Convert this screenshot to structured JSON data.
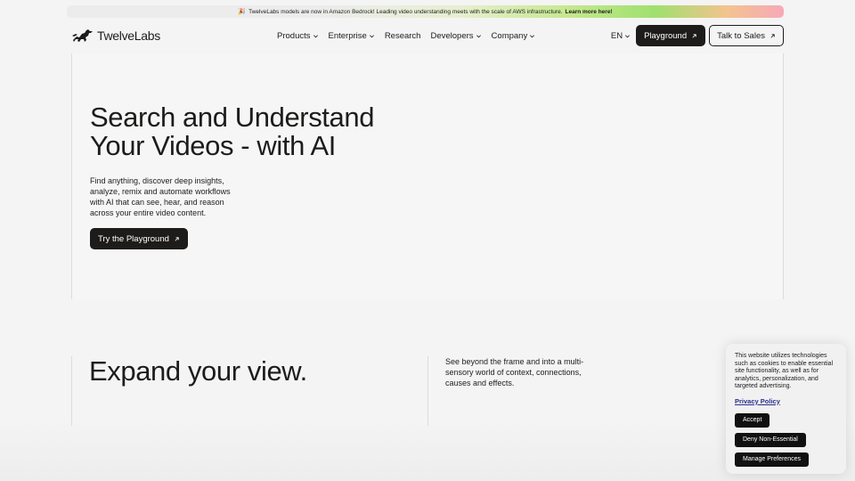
{
  "announcement": {
    "emoji": "🎉",
    "text": "TwelveLabs models are now in Amazon Bedrock! Leading video understanding meets with the scale of AWS infrastructure.",
    "link": "Learn more here!"
  },
  "nav": {
    "brand": "TwelveLabs",
    "menu": [
      {
        "label": "Products",
        "has_dropdown": true
      },
      {
        "label": "Enterprise",
        "has_dropdown": true
      },
      {
        "label": "Research",
        "has_dropdown": false
      },
      {
        "label": "Developers",
        "has_dropdown": true
      },
      {
        "label": "Company",
        "has_dropdown": true
      }
    ],
    "language": "EN",
    "playground_label": "Playground",
    "sales_label": "Talk to Sales"
  },
  "hero": {
    "title_line1": "Search and Understand",
    "title_line2": "Your Videos - with AI",
    "description": "Find anything, discover deep insights, analyze, remix and automate workflows with AI that can see, hear, and reason across your entire video content.",
    "cta_label": "Try the Playground"
  },
  "expand": {
    "title": "Expand your view.",
    "description": "See beyond the frame and into a multi-sensory world of context, connections, causes and effects."
  },
  "cookie": {
    "text": "This website utilizes technologies such as cookies to enable essential site functionality, as well as for analytics, personalization, and targeted advertising.",
    "policy_link": "Privacy Policy",
    "accept_label": "Accept",
    "deny_label": "Deny Non-Essential",
    "manage_label": "Manage Preferences"
  },
  "icons": {
    "logo": "running-horse-icon",
    "dropdown": "chevron-down-icon",
    "external": "arrow-up-right-icon"
  },
  "colors": {
    "ink": "#1d1c1b",
    "button_dark": "#1d1c1b",
    "link_blue": "#2c2f8f",
    "announce_green": "#9fe06e",
    "announce_pink": "#f6a9b9"
  }
}
